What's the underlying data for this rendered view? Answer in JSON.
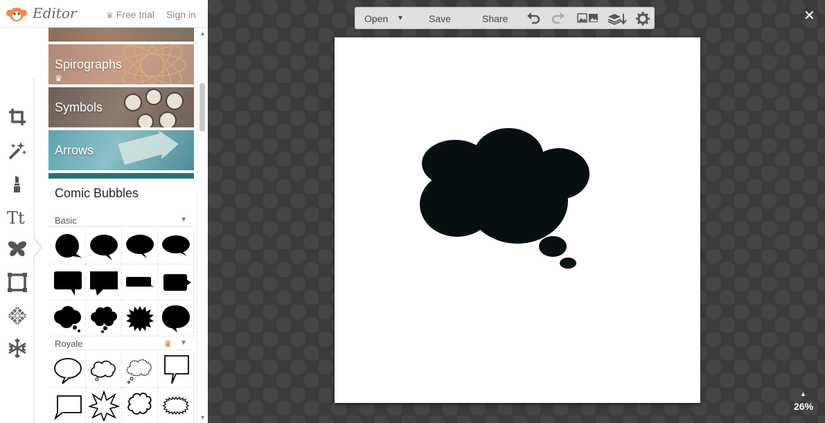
{
  "header": {
    "brand": "Editor",
    "free_trial": "Free trial",
    "sign_in": "Sign in"
  },
  "tools": [
    {
      "name": "crop-icon"
    },
    {
      "name": "magic-wand-icon"
    },
    {
      "name": "lipstick-icon"
    },
    {
      "name": "text-icon"
    },
    {
      "name": "butterfly-icon",
      "active": true
    },
    {
      "name": "frame-icon"
    },
    {
      "name": "texture-icon"
    },
    {
      "name": "snowflake-icon"
    }
  ],
  "categories": [
    {
      "label": "Spirographs",
      "premium": true
    },
    {
      "label": "Symbols",
      "premium": false
    },
    {
      "label": "Arrows",
      "premium": false
    }
  ],
  "panel": {
    "title": "Comic Bubbles",
    "sections": [
      {
        "name": "Basic",
        "premium": false
      },
      {
        "name": "Royale",
        "premium": true
      }
    ]
  },
  "toolbar": {
    "open": "Open",
    "save": "Save",
    "share": "Share"
  },
  "zoom": "26%",
  "colors": {
    "bubble": "#061012",
    "premium_crown": "#c8782a"
  }
}
